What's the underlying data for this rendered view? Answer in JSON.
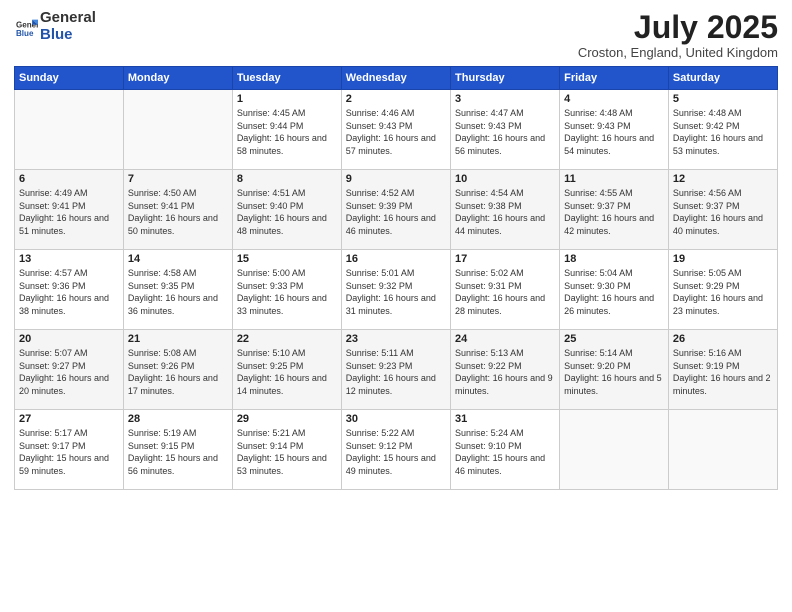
{
  "logo": {
    "general": "General",
    "blue": "Blue"
  },
  "title": "July 2025",
  "location": "Croston, England, United Kingdom",
  "days_of_week": [
    "Sunday",
    "Monday",
    "Tuesday",
    "Wednesday",
    "Thursday",
    "Friday",
    "Saturday"
  ],
  "weeks": [
    [
      {
        "day": "",
        "info": ""
      },
      {
        "day": "",
        "info": ""
      },
      {
        "day": "1",
        "info": "Sunrise: 4:45 AM\nSunset: 9:44 PM\nDaylight: 16 hours and 58 minutes."
      },
      {
        "day": "2",
        "info": "Sunrise: 4:46 AM\nSunset: 9:43 PM\nDaylight: 16 hours and 57 minutes."
      },
      {
        "day": "3",
        "info": "Sunrise: 4:47 AM\nSunset: 9:43 PM\nDaylight: 16 hours and 56 minutes."
      },
      {
        "day": "4",
        "info": "Sunrise: 4:48 AM\nSunset: 9:43 PM\nDaylight: 16 hours and 54 minutes."
      },
      {
        "day": "5",
        "info": "Sunrise: 4:48 AM\nSunset: 9:42 PM\nDaylight: 16 hours and 53 minutes."
      }
    ],
    [
      {
        "day": "6",
        "info": "Sunrise: 4:49 AM\nSunset: 9:41 PM\nDaylight: 16 hours and 51 minutes."
      },
      {
        "day": "7",
        "info": "Sunrise: 4:50 AM\nSunset: 9:41 PM\nDaylight: 16 hours and 50 minutes."
      },
      {
        "day": "8",
        "info": "Sunrise: 4:51 AM\nSunset: 9:40 PM\nDaylight: 16 hours and 48 minutes."
      },
      {
        "day": "9",
        "info": "Sunrise: 4:52 AM\nSunset: 9:39 PM\nDaylight: 16 hours and 46 minutes."
      },
      {
        "day": "10",
        "info": "Sunrise: 4:54 AM\nSunset: 9:38 PM\nDaylight: 16 hours and 44 minutes."
      },
      {
        "day": "11",
        "info": "Sunrise: 4:55 AM\nSunset: 9:37 PM\nDaylight: 16 hours and 42 minutes."
      },
      {
        "day": "12",
        "info": "Sunrise: 4:56 AM\nSunset: 9:37 PM\nDaylight: 16 hours and 40 minutes."
      }
    ],
    [
      {
        "day": "13",
        "info": "Sunrise: 4:57 AM\nSunset: 9:36 PM\nDaylight: 16 hours and 38 minutes."
      },
      {
        "day": "14",
        "info": "Sunrise: 4:58 AM\nSunset: 9:35 PM\nDaylight: 16 hours and 36 minutes."
      },
      {
        "day": "15",
        "info": "Sunrise: 5:00 AM\nSunset: 9:33 PM\nDaylight: 16 hours and 33 minutes."
      },
      {
        "day": "16",
        "info": "Sunrise: 5:01 AM\nSunset: 9:32 PM\nDaylight: 16 hours and 31 minutes."
      },
      {
        "day": "17",
        "info": "Sunrise: 5:02 AM\nSunset: 9:31 PM\nDaylight: 16 hours and 28 minutes."
      },
      {
        "day": "18",
        "info": "Sunrise: 5:04 AM\nSunset: 9:30 PM\nDaylight: 16 hours and 26 minutes."
      },
      {
        "day": "19",
        "info": "Sunrise: 5:05 AM\nSunset: 9:29 PM\nDaylight: 16 hours and 23 minutes."
      }
    ],
    [
      {
        "day": "20",
        "info": "Sunrise: 5:07 AM\nSunset: 9:27 PM\nDaylight: 16 hours and 20 minutes."
      },
      {
        "day": "21",
        "info": "Sunrise: 5:08 AM\nSunset: 9:26 PM\nDaylight: 16 hours and 17 minutes."
      },
      {
        "day": "22",
        "info": "Sunrise: 5:10 AM\nSunset: 9:25 PM\nDaylight: 16 hours and 14 minutes."
      },
      {
        "day": "23",
        "info": "Sunrise: 5:11 AM\nSunset: 9:23 PM\nDaylight: 16 hours and 12 minutes."
      },
      {
        "day": "24",
        "info": "Sunrise: 5:13 AM\nSunset: 9:22 PM\nDaylight: 16 hours and 9 minutes."
      },
      {
        "day": "25",
        "info": "Sunrise: 5:14 AM\nSunset: 9:20 PM\nDaylight: 16 hours and 5 minutes."
      },
      {
        "day": "26",
        "info": "Sunrise: 5:16 AM\nSunset: 9:19 PM\nDaylight: 16 hours and 2 minutes."
      }
    ],
    [
      {
        "day": "27",
        "info": "Sunrise: 5:17 AM\nSunset: 9:17 PM\nDaylight: 15 hours and 59 minutes."
      },
      {
        "day": "28",
        "info": "Sunrise: 5:19 AM\nSunset: 9:15 PM\nDaylight: 15 hours and 56 minutes."
      },
      {
        "day": "29",
        "info": "Sunrise: 5:21 AM\nSunset: 9:14 PM\nDaylight: 15 hours and 53 minutes."
      },
      {
        "day": "30",
        "info": "Sunrise: 5:22 AM\nSunset: 9:12 PM\nDaylight: 15 hours and 49 minutes."
      },
      {
        "day": "31",
        "info": "Sunrise: 5:24 AM\nSunset: 9:10 PM\nDaylight: 15 hours and 46 minutes."
      },
      {
        "day": "",
        "info": ""
      },
      {
        "day": "",
        "info": ""
      }
    ]
  ]
}
